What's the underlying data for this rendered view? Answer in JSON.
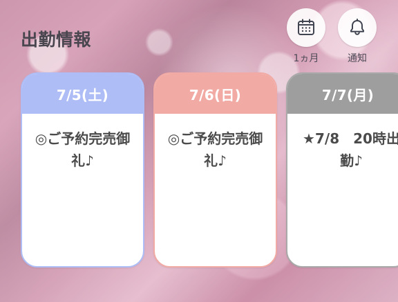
{
  "header": {
    "title": "出勤情報"
  },
  "actions": {
    "calendar_label": "1ヵ月",
    "notification_label": "通知",
    "calendar_icon": "calendar-icon",
    "notification_icon": "bell-icon"
  },
  "cards": [
    {
      "date": "7/5(土)",
      "text": "◎ご予約完売御礼♪",
      "header_color": "#aebdf6"
    },
    {
      "date": "7/6(日)",
      "text": "◎ご予約完売御礼♪",
      "header_color": "#f1aaa4"
    },
    {
      "date": "7/7(月)",
      "line1": "★7/8　20時出",
      "line2": "勤♪",
      "header_color": "#9e9e9e"
    }
  ]
}
